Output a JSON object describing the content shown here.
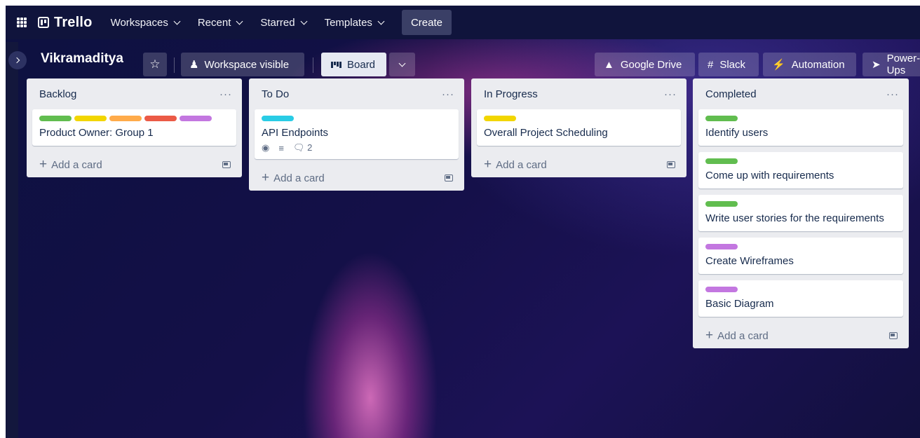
{
  "nav": {
    "logo": "Trello",
    "items": [
      {
        "label": "Workspaces"
      },
      {
        "label": "Recent"
      },
      {
        "label": "Starred"
      },
      {
        "label": "Templates"
      }
    ],
    "create_label": "Create"
  },
  "board": {
    "title": "Vikramaditya",
    "visibility_label": "Workspace visible",
    "view_label": "Board",
    "powerups": [
      {
        "label": "Google Drive",
        "icon": "google-drive-icon"
      },
      {
        "label": "Slack",
        "icon": "slack-icon"
      },
      {
        "label": "Automation",
        "icon": "automation-bolt-icon"
      },
      {
        "label": "Power-Ups",
        "icon": "rocket-icon"
      }
    ]
  },
  "lists": [
    {
      "title": "Backlog",
      "add_label": "Add a card",
      "cards": [
        {
          "title": "Product Owner: Group 1",
          "labels": [
            "#61bd4f",
            "#f2d600",
            "#ffab4a",
            "#eb5a46",
            "#c377e0"
          ]
        }
      ]
    },
    {
      "title": "To Do",
      "add_label": "Add a card",
      "cards": [
        {
          "title": "API Endpoints",
          "labels": [
            "#29cce5"
          ],
          "badges": {
            "watching": true,
            "description": true,
            "comments": "2"
          }
        }
      ]
    },
    {
      "title": "In Progress",
      "add_label": "Add a card",
      "cards": [
        {
          "title": "Overall Project Scheduling",
          "labels": [
            "#f2d600"
          ]
        }
      ]
    },
    {
      "title": "Completed",
      "add_label": "Add a card",
      "cards": [
        {
          "title": "Identify users",
          "labels": [
            "#61bd4f"
          ]
        },
        {
          "title": "Come up with requirements",
          "labels": [
            "#61bd4f"
          ]
        },
        {
          "title": "Write user stories for the requirements",
          "labels": [
            "#61bd4f"
          ]
        },
        {
          "title": "Create Wireframes",
          "labels": [
            "#c377e0"
          ]
        },
        {
          "title": "Basic Diagram",
          "labels": [
            "#c377e0"
          ]
        }
      ]
    }
  ]
}
